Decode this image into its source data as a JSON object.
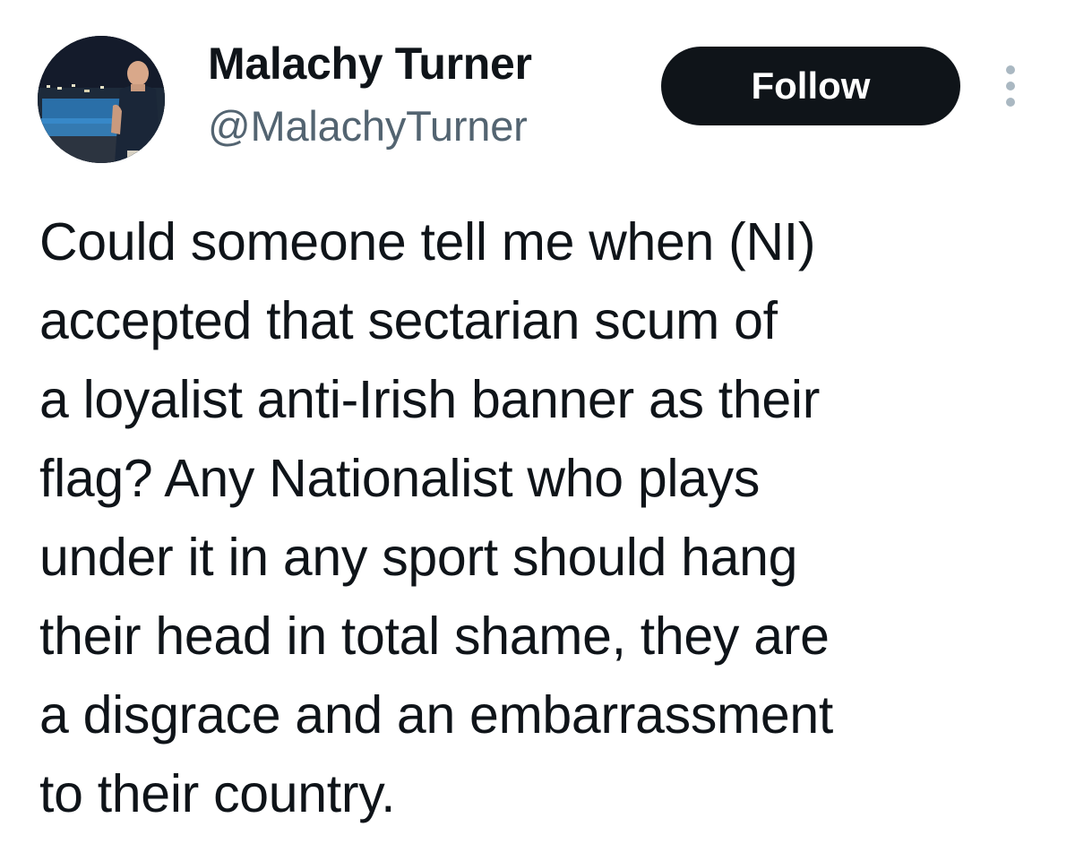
{
  "author": {
    "display_name": "Malachy Turner",
    "handle": "@MalachyTurner",
    "avatar_icon": "profile-photo"
  },
  "actions": {
    "follow_label": "Follow",
    "more_icon": "more-options-icon"
  },
  "tweet": {
    "text": "Could someone tell me when (NI)\naccepted that sectarian scum of\na loyalist anti-Irish banner as their\nflag? Any Nationalist who plays\nunder it in any sport should hang\ntheir head in total shame, they are\na disgrace and an embarrassment\nto their country."
  },
  "colors": {
    "text": "#0f1419",
    "secondary_text": "#536471",
    "button_bg": "#0f1419",
    "button_text": "#ffffff",
    "more_icon": "#aab8c2"
  }
}
